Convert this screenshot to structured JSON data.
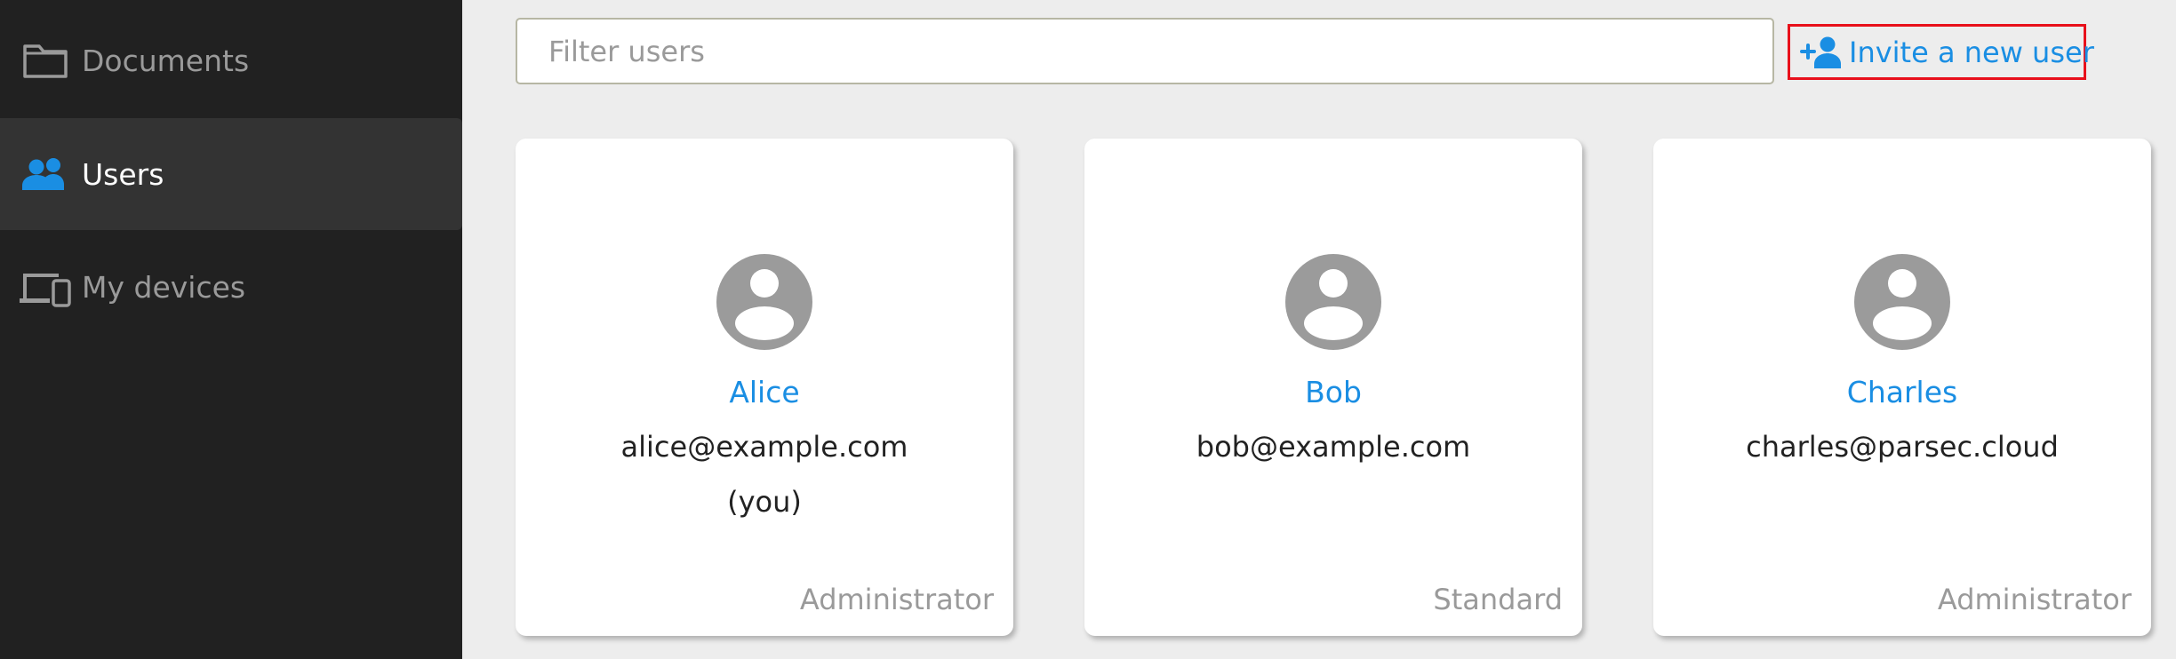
{
  "sidebar": {
    "items": [
      {
        "label": "Documents",
        "icon": "folder-icon",
        "active": false
      },
      {
        "label": "Users",
        "icon": "users-icon",
        "active": true
      },
      {
        "label": "My devices",
        "icon": "devices-icon",
        "active": false
      }
    ]
  },
  "toolbar": {
    "filter_placeholder": "Filter users",
    "filter_value": "",
    "invite_label": "Invite a new user",
    "invite_icon": "add-user-icon"
  },
  "users": [
    {
      "name": "Alice",
      "email": "alice@example.com",
      "you": "(you)",
      "role": "Administrator"
    },
    {
      "name": "Bob",
      "email": "bob@example.com",
      "you": "",
      "role": "Standard"
    },
    {
      "name": "Charles",
      "email": "charles@parsec.cloud",
      "you": "",
      "role": "Administrator"
    }
  ],
  "colors": {
    "sidebar_bg": "#212121",
    "sidebar_active_bg": "#333333",
    "accent": "#1a8ee3",
    "avatar": "#9b9b9b",
    "highlight_border": "#e8101b",
    "content_bg": "#ededed"
  }
}
